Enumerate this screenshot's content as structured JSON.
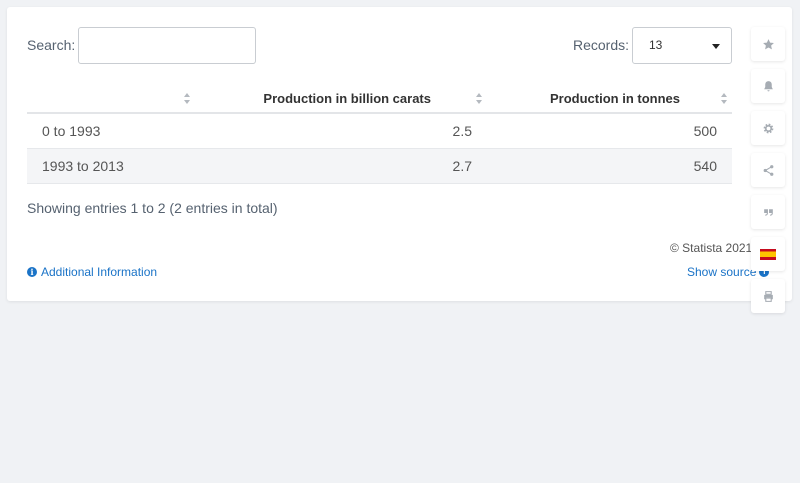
{
  "search": {
    "label": "Search:",
    "value": "",
    "placeholder": ""
  },
  "records": {
    "label": "Records:",
    "value": "13"
  },
  "table": {
    "columns": [
      "",
      "Production in billion carats",
      "Production in tonnes"
    ],
    "rows": [
      [
        "0 to 1993",
        "2.5",
        "500"
      ],
      [
        "1993 to 2013",
        "2.7",
        "540"
      ]
    ]
  },
  "info_text": "Showing entries 1 to 2 (2 entries in total)",
  "footer": {
    "copyright": "© Statista 2021",
    "additional_info": "Additional Information",
    "show_source": "Show source"
  },
  "toolbar": {
    "icons": [
      "star-icon",
      "bell-icon",
      "gear-icon",
      "share-icon",
      "quote-icon",
      "flag-spain-icon",
      "print-icon"
    ]
  }
}
